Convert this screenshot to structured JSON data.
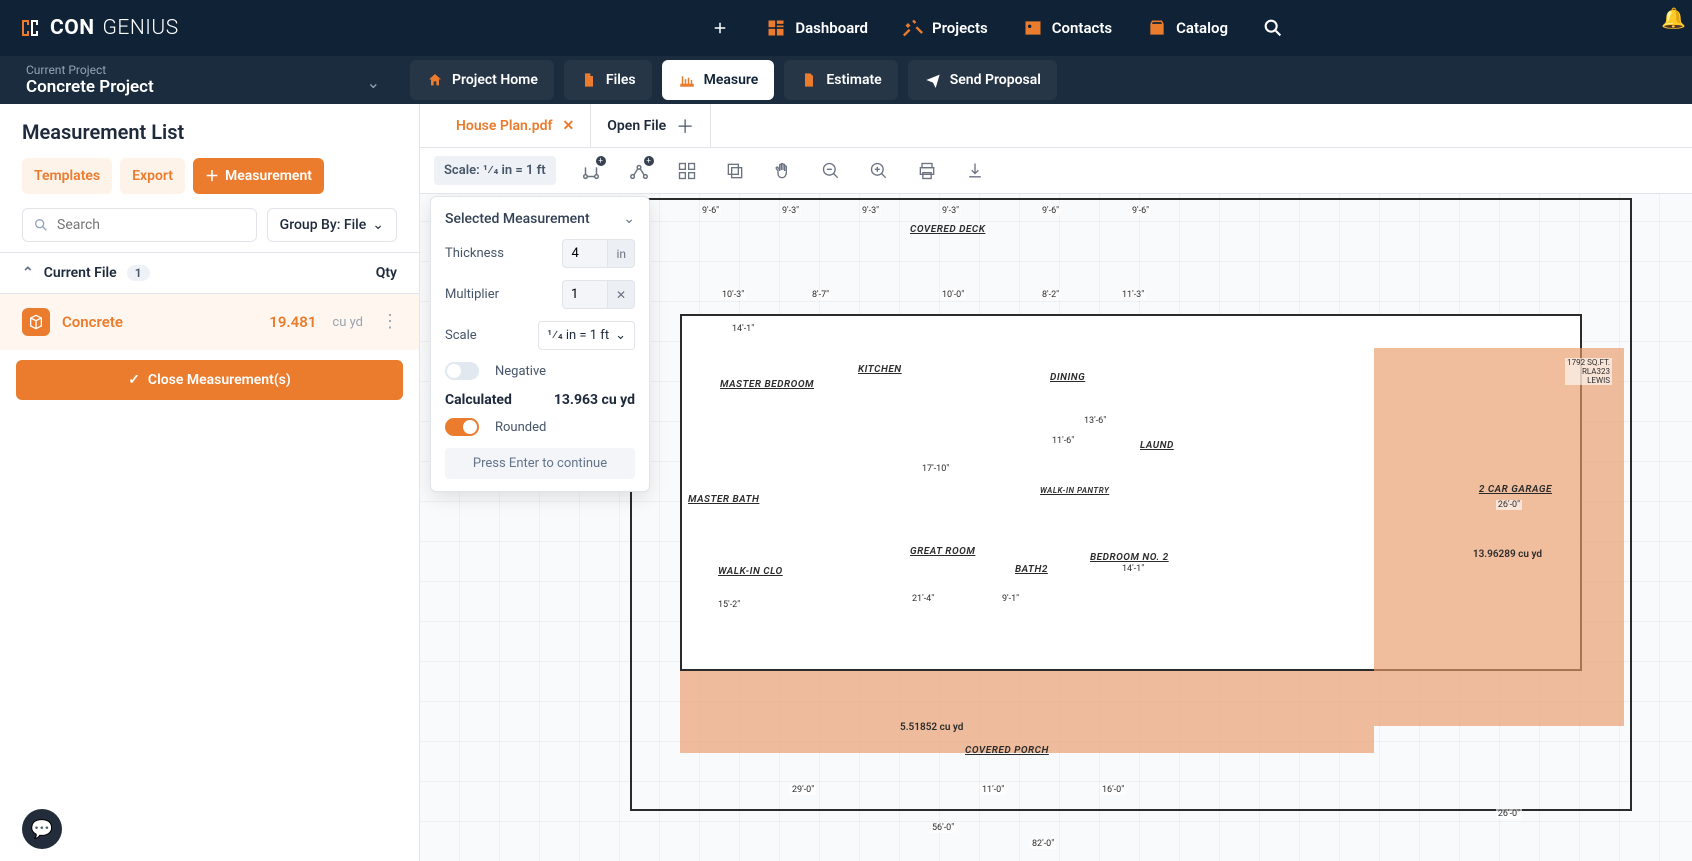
{
  "brand": {
    "con": "CON",
    "genius": "GENIUS"
  },
  "topnav": {
    "dashboard": "Dashboard",
    "projects": "Projects",
    "contacts": "Contacts",
    "catalog": "Catalog"
  },
  "project": {
    "label": "Current Project",
    "name": "Concrete Project"
  },
  "tabs": {
    "home": "Project Home",
    "files": "Files",
    "measure": "Measure",
    "estimate": "Estimate",
    "proposal": "Send Proposal"
  },
  "leftpanel": {
    "title": "Measurement List",
    "templates": "Templates",
    "export": "Export",
    "measurement": "Measurement",
    "search_ph": "Search",
    "groupby": "Group By: File",
    "currentfile": "Current File",
    "count": "1",
    "qty": "Qty",
    "item_name": "Concrete",
    "item_val": "19.481",
    "item_unit": "cu yd",
    "close": "Close Measurement(s)"
  },
  "filetabs": {
    "active": "House Plan.pdf",
    "open": "Open File"
  },
  "toolbar": {
    "scale": "Scale: 1⁄4 in = 1 ft"
  },
  "floating": {
    "head": "Selected Measurement",
    "thickness": "Thickness",
    "thickness_val": "4",
    "thickness_unit": "in",
    "multiplier": "Multiplier",
    "multiplier_val": "1",
    "scale": "Scale",
    "scale_val": "1⁄4 in = 1 ft",
    "negative": "Negative",
    "calculated": "Calculated",
    "calc_val": "13.963 cu yd",
    "rounded": "Rounded",
    "hint": "Press Enter to continue"
  },
  "plan": {
    "covered_deck": "COVERED DECK",
    "master_bed": "MASTER BEDROOM",
    "kitchen": "KITCHEN",
    "dining": "DINING",
    "great": "GREAT ROOM",
    "mbath": "MASTER BATH",
    "bath2": "BATH2",
    "bed2": "BEDROOM NO. 2",
    "laund": "LAUND",
    "walkin": "WALK-IN CLO",
    "pantry": "WALK-IN PANTRY",
    "garage": "2 CAR GARAGE",
    "porch": "COVERED PORCH",
    "hl_garage": "13.96289 cu yd",
    "hl_bottom": "5.51852 cu yd",
    "garage_sqft": "1792 SQ.FT.\nRLA323\nLEWIS"
  }
}
